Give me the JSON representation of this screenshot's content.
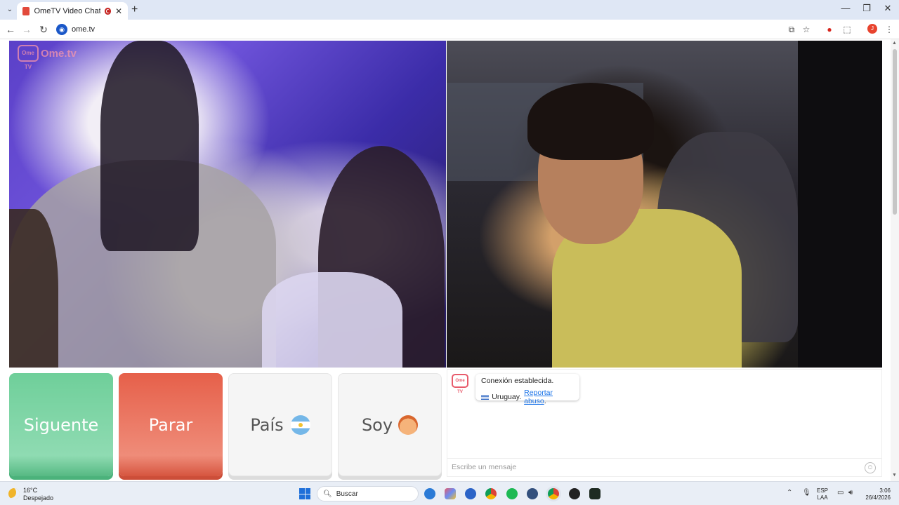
{
  "browser": {
    "tab_title": "OmeTV Video Chat — Ome",
    "tab_close": "✕",
    "new_tab": "+",
    "url": "ome.tv",
    "window_minimize": "—",
    "window_restore": "❐",
    "window_close": "✕",
    "profile_initial": "J"
  },
  "page": {
    "logo_text": "Ome.tv",
    "logo_tv": "Ome TV",
    "buttons": {
      "next": "Siguente",
      "stop": "Parar",
      "country": "País",
      "gender": "Soy"
    },
    "chat": {
      "system_message": "Conexión establecida.",
      "country": "Uruguay.",
      "report_link": "Reportar abuso",
      "report_suffix": ".",
      "input_placeholder": "Escribe un mensaje"
    }
  },
  "taskbar": {
    "temperature": "16°C",
    "weather": "Despejado",
    "search_placeholder": "Buscar",
    "lang_line1": "ESP",
    "lang_line2": "LAA",
    "time": "3:06",
    "date": "26/4/2026"
  },
  "colors": {
    "next_button": "#6fcf9a",
    "stop_button": "#e6604a",
    "link": "#1a73e8"
  }
}
